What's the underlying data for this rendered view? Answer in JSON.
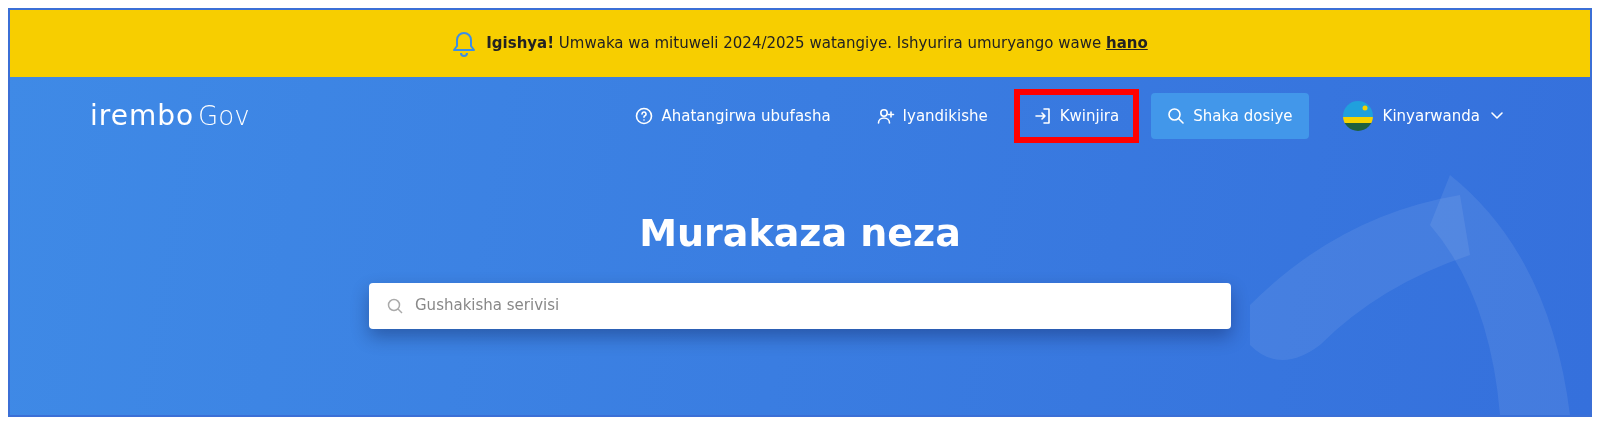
{
  "banner": {
    "text": "**Igishya!** Umwaka wa mituweli 2024/2025 watangiye. Ishyurira umuryango wawe",
    "link": "hano"
  },
  "logo": {
    "brand": "irembo",
    "suffix": "Gov"
  },
  "nav": [
    {
      "kind": "help",
      "label": "Ahatangirwa ubufasha",
      "highlighted": false
    },
    {
      "kind": "register",
      "label": "Iyandikishe",
      "highlighted": false
    },
    {
      "kind": "login",
      "label": "Kwinjira",
      "highlighted": true
    },
    {
      "kind": "search",
      "label": "Shaka dosiye",
      "highlighted": false
    }
  ],
  "language": {
    "label": "Kinyarwanda"
  },
  "hero": {
    "title": "Murakaza neza",
    "search": {
      "placeholder": "Gushakisha serivisi"
    }
  }
}
